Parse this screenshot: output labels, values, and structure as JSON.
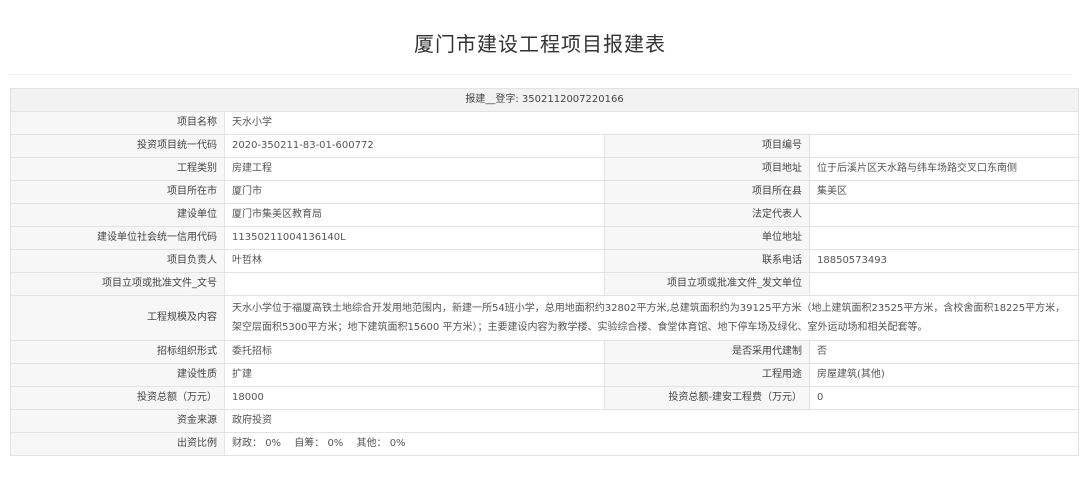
{
  "title": "厦门市建设工程项目报建表",
  "registration": {
    "label": "报建__登字:",
    "number": "3502112007220166"
  },
  "rows": {
    "project_name": {
      "label": "项目名称",
      "value": "天水小学"
    },
    "invest_code": {
      "label": "投资项目统一代码",
      "value": "2020-350211-83-01-600772"
    },
    "project_no": {
      "label": "项目编号",
      "value": ""
    },
    "project_type": {
      "label": "工程类别",
      "value": "房建工程"
    },
    "address": {
      "label": "项目地址",
      "value": "位于后溪片区天水路与纬车场路交叉口东南侧"
    },
    "city": {
      "label": "项目所在市",
      "value": "厦门市"
    },
    "county": {
      "label": "项目所在县",
      "value": "集美区"
    },
    "builder": {
      "label": "建设单位",
      "value": "厦门市集美区教育局"
    },
    "legal_rep": {
      "label": "法定代表人",
      "value": ""
    },
    "credit_code": {
      "label": "建设单位社会统一信用代码",
      "value": "11350211004136140L"
    },
    "unit_address": {
      "label": "单位地址",
      "value": ""
    },
    "manager": {
      "label": "项目负责人",
      "value": "叶哲林"
    },
    "phone": {
      "label": "联系电话",
      "value": "18850573493"
    },
    "approval_doc": {
      "label": "项目立项或批准文件_文号",
      "value": ""
    },
    "approval_unit": {
      "label": "项目立项或批准文件_发文单位",
      "value": ""
    },
    "scale": {
      "label": "工程规模及内容",
      "value": "天水小学位于福厦高铁土地综合开发用地范围内，新建一所54班小学，总用地面积约32802平方米,总建筑面积约为39125平方米（地上建筑面积23525平方米，含校舍面积18225平方米，架空层面积5300平方米；地下建筑面积15600 平方米）；主要建设内容为教学楼、实验综合楼、食堂体育馆、地下停车场及绿化、室外运动场和相关配套等。"
    },
    "tender_form": {
      "label": "招标组织形式",
      "value": "委托招标"
    },
    "agent_system": {
      "label": "是否采用代建制",
      "value": "否"
    },
    "build_nature": {
      "label": "建设性质",
      "value": "扩建"
    },
    "purpose": {
      "label": "工程用途",
      "value": "房屋建筑(其他)"
    },
    "total_invest": {
      "label": "投资总额（万元）",
      "value": "18000"
    },
    "install_cost": {
      "label": "投资总额-建安工程费（万元）",
      "value": "0"
    },
    "fund_source": {
      "label": "资金来源",
      "value": "政府投资"
    },
    "ratio": {
      "label": "出资比例",
      "fiscal_label": "财政：",
      "fiscal": "0%",
      "self_label": "自筹：",
      "self": "0%",
      "other_label": "其他：",
      "other": "0%"
    }
  }
}
